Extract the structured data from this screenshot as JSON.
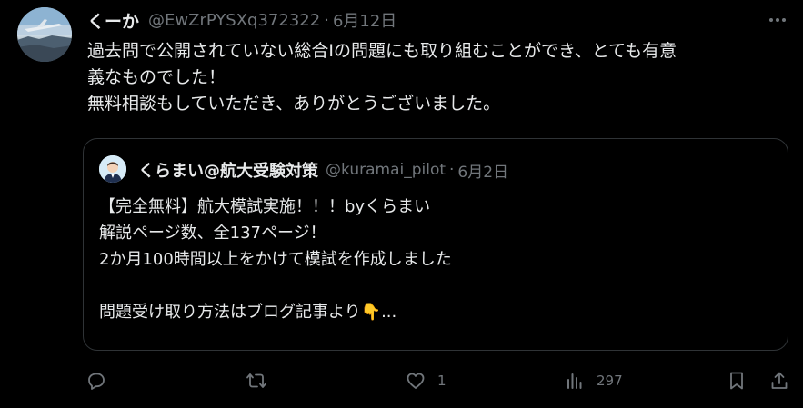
{
  "tweet": {
    "display_name": "くーか",
    "handle": "@EwZrPYSXq372322",
    "separator": "·",
    "date": "6月12日",
    "lines": [
      "過去問で公開されていない総合Iの問題にも取り組むことができ、とても有意",
      "義なものでした！",
      "無料相談もしていただき、ありがとうございました。"
    ]
  },
  "quote": {
    "display_name": "くらまい@航大受験対策",
    "handle": "@kuramai_pilot",
    "separator": "·",
    "date": "6月2日",
    "lines": [
      "【完全無料】航大模試実施！！！byくらまい",
      "解説ページ数、全137ページ！",
      "2か月100時間以上をかけて模試を作成しました",
      "",
      "問題受け取り方法はブログ記事より"
    ],
    "emoji": "👇",
    "ellipsis": "..."
  },
  "actions": {
    "reply_count": "",
    "retweet_count": "",
    "like_count": "1",
    "views_count": "297"
  },
  "colors": {
    "background": "#000000",
    "text": "#e7e9ea",
    "muted": "#71767b",
    "border": "#2f3336"
  }
}
